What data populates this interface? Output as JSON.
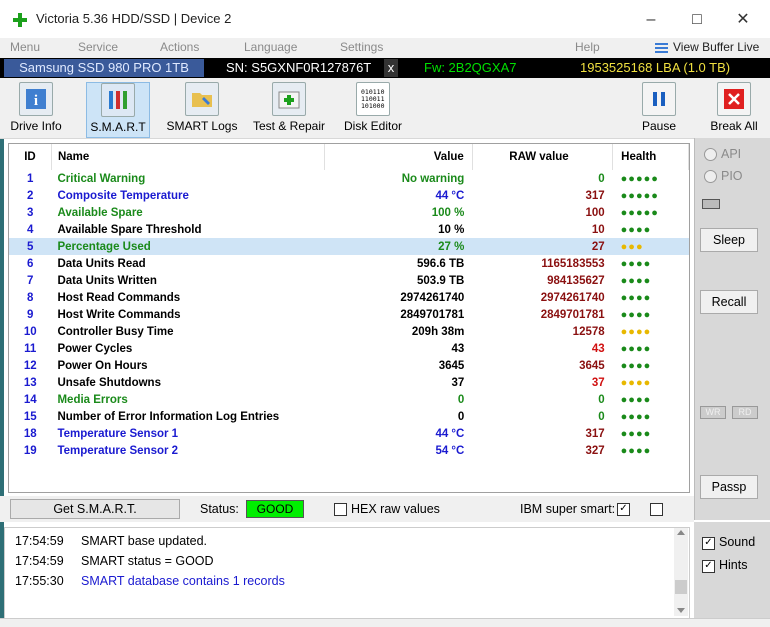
{
  "window": {
    "title": "Victoria 5.36 HDD/SSD | Device 2"
  },
  "menu": {
    "items": [
      "Menu",
      "Service",
      "Actions",
      "Language",
      "Settings",
      "Help"
    ],
    "view_buffer": "View Buffer Live"
  },
  "device": {
    "model": "Samsung SSD 980 PRO 1TB",
    "serial": "SN: S5GXNF0R127876T",
    "close": "x",
    "firmware": "Fw: 2B2QGXA7",
    "capacity": "1953525168 LBA (1.0 TB)"
  },
  "toolbar": {
    "drive_info": "Drive Info",
    "smart": "S.M.A.R.T",
    "smart_logs": "SMART Logs",
    "test_repair": "Test & Repair",
    "disk_editor": "Disk Editor",
    "pause": "Pause",
    "break_all": "Break All"
  },
  "table": {
    "headers": {
      "id": "ID",
      "name": "Name",
      "value": "Value",
      "raw": "RAW value",
      "health": "Health"
    },
    "rows": [
      {
        "id": "1",
        "name": "Critical Warning",
        "value": "No warning",
        "raw": "0",
        "health": "●●●●●",
        "nc": "g",
        "rc": "g",
        "hc": "g"
      },
      {
        "id": "2",
        "name": "Composite Temperature",
        "value": "44 °C",
        "raw": "317",
        "health": "●●●●●",
        "nc": "b",
        "rc": "r",
        "hc": "g"
      },
      {
        "id": "3",
        "name": "Available Spare",
        "value": "100 %",
        "raw": "100",
        "health": "●●●●●",
        "nc": "g",
        "rc": "r",
        "hc": "g"
      },
      {
        "id": "4",
        "name": "Available Spare Threshold",
        "value": "10 %",
        "raw": "10",
        "health": "●●●●",
        "nc": "k",
        "rc": "r",
        "hc": "g"
      },
      {
        "id": "5",
        "name": "Percentage Used",
        "value": "27 %",
        "raw": "27",
        "health": "●●●",
        "nc": "g",
        "rc": "r",
        "hc": "y"
      },
      {
        "id": "6",
        "name": "Data Units Read",
        "value": "596.6 TB",
        "raw": "1165183553",
        "health": "●●●●",
        "nc": "k",
        "rc": "r",
        "hc": "g"
      },
      {
        "id": "7",
        "name": "Data Units Written",
        "value": "503.9 TB",
        "raw": "984135627",
        "health": "●●●●",
        "nc": "k",
        "rc": "r",
        "hc": "g"
      },
      {
        "id": "8",
        "name": "Host Read Commands",
        "value": "2974261740",
        "raw": "2974261740",
        "health": "●●●●",
        "nc": "k",
        "rc": "r",
        "hc": "g"
      },
      {
        "id": "9",
        "name": "Host Write Commands",
        "value": "2849701781",
        "raw": "2849701781",
        "health": "●●●●",
        "nc": "k",
        "rc": "r",
        "hc": "g"
      },
      {
        "id": "10",
        "name": "Controller Busy Time",
        "value": "209h 38m",
        "raw": "12578",
        "health": "●●●●",
        "nc": "k",
        "rc": "r",
        "hc": "y"
      },
      {
        "id": "11",
        "name": "Power Cycles",
        "value": "43",
        "raw": "43",
        "health": "●●●●",
        "nc": "k",
        "rc": "rr",
        "hc": "g"
      },
      {
        "id": "12",
        "name": "Power On Hours",
        "value": "3645",
        "raw": "3645",
        "health": "●●●●",
        "nc": "k",
        "rc": "r",
        "hc": "g"
      },
      {
        "id": "13",
        "name": "Unsafe Shutdowns",
        "value": "37",
        "raw": "37",
        "health": "●●●●",
        "nc": "k",
        "rc": "rr",
        "hc": "y"
      },
      {
        "id": "14",
        "name": "Media Errors",
        "value": "0",
        "raw": "0",
        "health": "●●●●",
        "nc": "g",
        "rc": "g",
        "hc": "g"
      },
      {
        "id": "15",
        "name": "Number of Error Information Log Entries",
        "value": "0",
        "raw": "0",
        "health": "●●●●",
        "nc": "k",
        "rc": "g",
        "hc": "g"
      },
      {
        "id": "18",
        "name": "Temperature Sensor 1",
        "value": "44 °C",
        "raw": "317",
        "health": "●●●●",
        "nc": "b",
        "rc": "r",
        "hc": "g"
      },
      {
        "id": "19",
        "name": "Temperature Sensor 2",
        "value": "54 °C",
        "raw": "327",
        "health": "●●●●",
        "nc": "b",
        "rc": "r",
        "hc": "g"
      }
    ]
  },
  "statusbar": {
    "get_smart": "Get S.M.A.R.T.",
    "status_label": "Status:",
    "status_value": "GOOD",
    "hex_raw": "HEX raw values",
    "ibm_label": "IBM super smart:",
    "ibm_check": "✓"
  },
  "right_panel": {
    "api": "API",
    "pio": "PIO",
    "sleep": "Sleep",
    "recall": "Recall",
    "wr": "WR",
    "rd": "RD",
    "passp": "Passp",
    "sound": "Sound",
    "hints": "Hints",
    "check": "✓"
  },
  "log": [
    {
      "time": "17:54:59",
      "text": "SMART base updated.",
      "color": "#000000"
    },
    {
      "time": "17:54:59",
      "text": "SMART status = GOOD",
      "color": "#000000"
    },
    {
      "time": "17:55:30",
      "text": "SMART database contains 1 records",
      "color": "#1a1ad0"
    }
  ],
  "colors": {
    "good": "#00ee00",
    "health_green": "#1a8a1a",
    "health_yellow": "#e8b800",
    "device_green": "#00e000",
    "device_yellow": "#f0e040"
  }
}
